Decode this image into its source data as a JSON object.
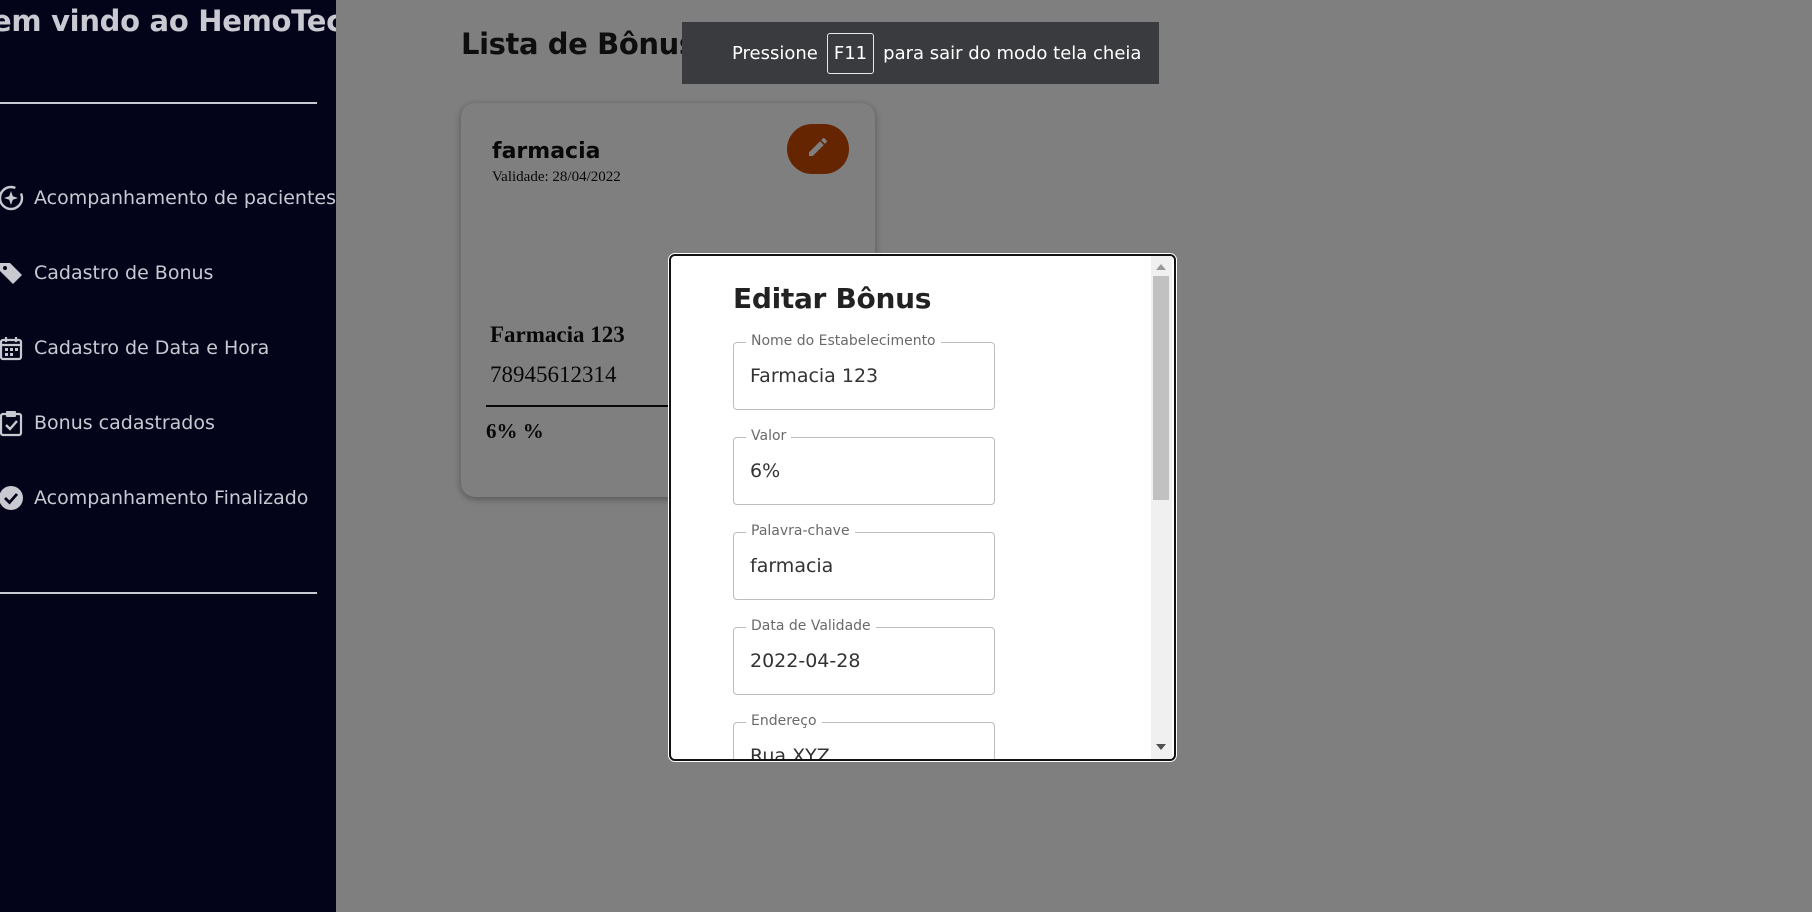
{
  "sidebar": {
    "welcome": "em vindo ao HemoTech",
    "items": [
      {
        "label": "Acompanhamento de pacientes",
        "icon": "patient-tracking-icon"
      },
      {
        "label": "Cadastro de Bonus",
        "icon": "tag-icon"
      },
      {
        "label": "Cadastro de Data e Hora",
        "icon": "calendar-icon"
      },
      {
        "label": "Bonus cadastrados",
        "icon": "clipboard-check-icon"
      },
      {
        "label": "Acompanhamento Finalizado",
        "icon": "check-circle-icon"
      }
    ]
  },
  "main": {
    "title": "Lista de Bônus Cadastrados",
    "card": {
      "keyword": "farmacia",
      "validity": "Validade: 28/04/2022",
      "establishment": "Farmacia 123",
      "phone": "78945612314",
      "percent": "6% %",
      "edit_icon": "pencil-icon"
    }
  },
  "toast": {
    "before": "Pressione",
    "key": "F11",
    "after": "para sair do modo tela cheia"
  },
  "dialog": {
    "title": "Editar Bônus",
    "fields": [
      {
        "label": "Nome do Estabelecimento",
        "value": "Farmacia 123"
      },
      {
        "label": "Valor",
        "value": "6%"
      },
      {
        "label": "Palavra-chave",
        "value": "farmacia"
      },
      {
        "label": "Data de Validade",
        "value": "2022-04-28"
      },
      {
        "label": "Endereço",
        "value": "Rua XYZ"
      }
    ]
  },
  "colors": {
    "sidebar_bg": "#03041a",
    "accent": "#c94a00",
    "overlay": "rgba(0,0,0,0.5)"
  }
}
